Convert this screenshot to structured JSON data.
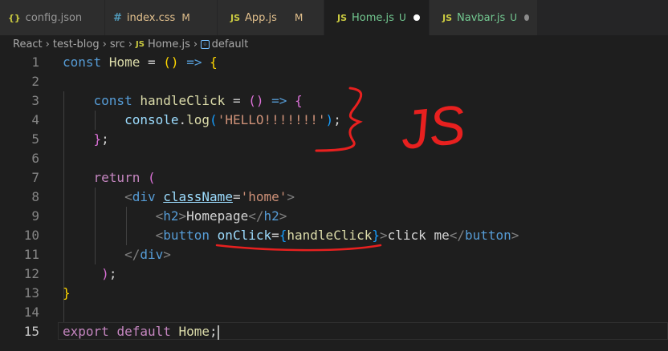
{
  "tabs": [
    {
      "icon": "{}",
      "name": "config.json",
      "status": "",
      "active": false
    },
    {
      "icon": "#",
      "name": "index.css",
      "status": "M",
      "active": false
    },
    {
      "icon": "JS",
      "name": "App.js",
      "status": "M",
      "active": false
    },
    {
      "icon": "JS",
      "name": "Home.js",
      "status": "U",
      "active": true
    },
    {
      "icon": "JS",
      "name": "Navbar.js",
      "status": "U",
      "active": false
    }
  ],
  "breadcrumb": {
    "parts": [
      "React",
      "test-blog",
      "src",
      "Home.js",
      "default"
    ],
    "file_icon": "JS"
  },
  "line_numbers": [
    "1",
    "2",
    "3",
    "4",
    "5",
    "6",
    "7",
    "8",
    "9",
    "10",
    "11",
    "12",
    "13",
    "14",
    "15"
  ],
  "current_line": 15,
  "code": {
    "l1": {
      "kw": "const",
      "name": "Home",
      "op": "=",
      "open": "(",
      "close": ")",
      "arrow": "=>",
      "brace": "{"
    },
    "l3": {
      "kw": "const",
      "name": "handleClick",
      "op": "=",
      "open": "(",
      "close": ")",
      "arrow": "=>",
      "brace": "{"
    },
    "l4": {
      "obj": "console",
      "dot": ".",
      "method": "log",
      "open": "(",
      "str": "'HELLO!!!!!!!'",
      "close": ")",
      "semi": ";"
    },
    "l5": {
      "brace": "}",
      "semi": ";"
    },
    "l7": {
      "kw": "return",
      "paren": "("
    },
    "l8": {
      "lt": "<",
      "tag": "div",
      "attr": "className",
      "eq": "=",
      "val": "'home'",
      "gt": ">"
    },
    "l9": {
      "lt": "<",
      "tag": "h2",
      "gt": ">",
      "text": "Homepage",
      "lt2": "</",
      "tag2": "h2",
      "gt2": ">"
    },
    "l10": {
      "lt": "<",
      "tag": "button",
      "attr": "onClick",
      "eq": "=",
      "ob": "{",
      "val": "handleClick",
      "cb": "}",
      "gt": ">",
      "text": "click me",
      "lt2": "</",
      "tag2": "button",
      "gt2": ">"
    },
    "l11": {
      "lt": "</",
      "tag": "div",
      "gt": ">"
    },
    "l12": {
      "paren": ")",
      "semi": ";"
    },
    "l13": {
      "brace": "}"
    },
    "l15": {
      "kw1": "export",
      "kw2": "default",
      "name": "Home",
      "semi": ";"
    }
  },
  "annotation": {
    "text": "JS",
    "color": "#e8201f"
  },
  "colors": {
    "accent": "#1e1e1e",
    "untracked": "#73c991",
    "modified": "#e2c08d"
  }
}
